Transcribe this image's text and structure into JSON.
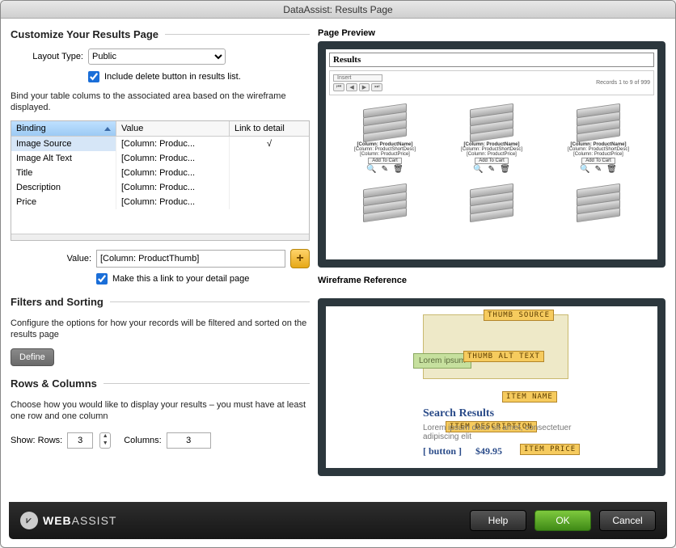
{
  "window": {
    "title": "DataAssist: Results Page"
  },
  "customize": {
    "heading": "Customize Your Results Page",
    "layout_label": "Layout Type:",
    "layout_value": "Public",
    "include_delete_label": "Include delete button in results list.",
    "bind_desc": "Bind your table colums to the associated area based on the wireframe displayed.",
    "table": {
      "col_binding": "Binding",
      "col_value": "Value",
      "col_link": "Link to detail",
      "rows": [
        {
          "binding": "Image Source",
          "value": "[Column: Produc...",
          "link": "√"
        },
        {
          "binding": "Image Alt Text",
          "value": "[Column: Produc...",
          "link": ""
        },
        {
          "binding": "Title",
          "value": "[Column: Produc...",
          "link": ""
        },
        {
          "binding": "Description",
          "value": "[Column: Produc...",
          "link": ""
        },
        {
          "binding": "Price",
          "value": "[Column: Produc...",
          "link": ""
        }
      ]
    },
    "value_label": "Value:",
    "value_input": "[Column: ProductThumb]",
    "link_detail_label": "Make this a link to your detail page"
  },
  "filters": {
    "heading": "Filters and Sorting",
    "desc": "Configure the options for how your records will be filtered and sorted on the results page",
    "define": "Define"
  },
  "rowscols": {
    "heading": "Rows & Columns",
    "desc": "Choose how you would like to display your results – you must have at least one row and one column",
    "show_label": "Show: Rows:",
    "rows_value": "3",
    "cols_label": "Columns:",
    "cols_value": "3"
  },
  "preview": {
    "label": "Page Preview",
    "results_heading": "Results",
    "insert": "Insert",
    "records_text": "Records 1 to 9 of 999",
    "card": {
      "name": "[Column: ProductName]",
      "desc": "[Column: ProductShortDesc]",
      "price": "[Column: ProductPrice]",
      "add": "Add To Cart"
    }
  },
  "wireframe": {
    "label": "Wireframe Reference",
    "thumb_source": "THUMB SOURCE",
    "thumb_alt": "THUMB ALT TEXT",
    "lorem": "Lorem ipsum",
    "item_name": "ITEM NAME",
    "search_results": "Search Results",
    "item_description": "ITEM DESCRIPTION",
    "lorem2": "Lorem ipsum dolor sit amet, consectetuer adipiscing elit",
    "button": "[ button ]",
    "price": "$49.95",
    "item_price": "ITEM PRICE"
  },
  "footer": {
    "brand_bold": "WEB",
    "brand_rest": "ASSIST",
    "help": "Help",
    "ok": "OK",
    "cancel": "Cancel"
  }
}
